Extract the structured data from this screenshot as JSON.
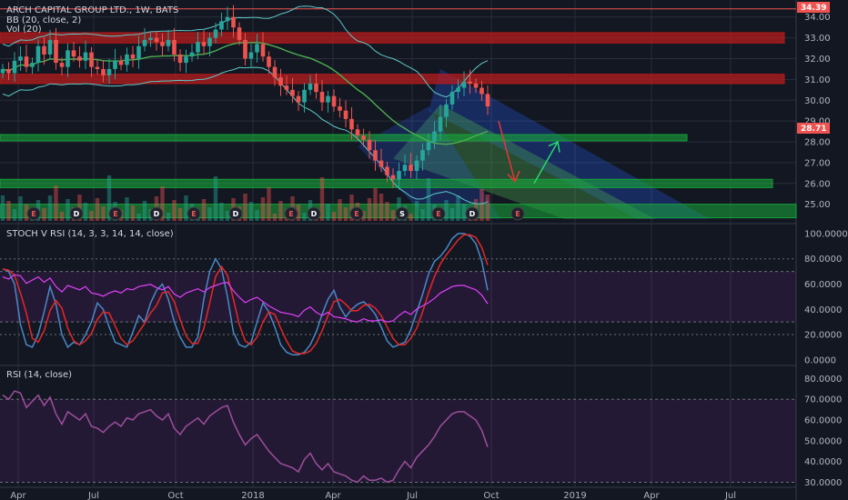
{
  "header": {
    "symbol_line": "ARCH CAPITAL GROUP LTD., 1W, BATS",
    "bb_label": "BB (20, close, 2)",
    "vol_label": "Vol (20)"
  },
  "price_tags": {
    "top": "34.39",
    "last": "28.71"
  },
  "earnings_markers": [
    "E",
    "D",
    "E",
    "D",
    "E",
    "D",
    "E",
    "D",
    "E",
    "S",
    "E",
    "D",
    "E"
  ],
  "colors": {
    "background": "#131722",
    "grid": "#2a2e39",
    "up": "#26a69a",
    "down": "#ef5350",
    "bb": "#5ec7c7",
    "sma": "#4caf50",
    "stoch_k": "#4a88c7",
    "stoch_d": "#e52727",
    "rsi": "#9c4f9c",
    "zone_red": "#b71c1c",
    "zone_green": "#17a83a"
  },
  "chart_data": [
    {
      "type": "candlestick",
      "title": "ARCH CAPITAL GROUP LTD., 1W, BATS",
      "x_ticks": [
        "Apr",
        "Jul",
        "Oct",
        "2018",
        "Apr",
        "Jul",
        "Oct",
        "2019",
        "Apr",
        "Jul"
      ],
      "y_ticks": [
        25.0,
        26.0,
        27.0,
        28.0,
        29.0,
        30.0,
        31.0,
        32.0,
        33.0,
        34.0
      ],
      "ylim": [
        24.2,
        34.6
      ],
      "close": [
        31.5,
        31.3,
        31.9,
        32.1,
        31.6,
        31.8,
        32.6,
        32.2,
        32.9,
        31.8,
        31.6,
        32.4,
        32.1,
        31.9,
        32.3,
        31.6,
        31.5,
        31.2,
        31.5,
        31.9,
        31.7,
        32.2,
        32.0,
        32.6,
        32.9,
        33.0,
        32.8,
        32.6,
        32.9,
        32.2,
        31.8,
        32.1,
        32.3,
        32.8,
        32.6,
        33.0,
        33.4,
        33.8,
        34.0,
        33.5,
        32.9,
        32.0,
        32.3,
        32.7,
        32.1,
        31.6,
        31.1,
        30.7,
        30.5,
        30.2,
        29.9,
        30.5,
        30.8,
        30.4,
        29.9,
        30.2,
        29.7,
        29.5,
        29.1,
        28.6,
        28.3,
        28.1,
        27.6,
        27.1,
        26.8,
        26.4,
        26.2,
        26.6,
        26.9,
        26.6,
        27.1,
        27.6,
        28.0,
        28.5,
        29.2,
        29.8,
        30.4,
        30.6,
        30.9,
        30.8,
        30.6,
        30.3,
        29.7
      ],
      "overlays": [
        "BB (20, close, 2)",
        "Vol (20)"
      ],
      "annotations": [
        "resistance zones 33.0, 31.0",
        "support zones 28.2, 26.0, 24.7",
        "regression channel",
        "down arrow",
        "up arrow"
      ]
    },
    {
      "type": "line",
      "title": "STOCH V RSI (14, 3, 3, 14, 14, close)",
      "y_ticks": [
        0,
        20,
        40,
        60,
        80,
        100
      ],
      "y_tick_labels": [
        "0.0000",
        "20.0000",
        "40.0000",
        "60.0000",
        "80.0000",
        "100.0000"
      ],
      "ylim": [
        -3,
        105
      ],
      "bands": [
        30,
        70
      ],
      "series": [
        {
          "name": "K",
          "values": [
            72,
            70,
            60,
            28,
            12,
            10,
            20,
            38,
            58,
            44,
            20,
            10,
            14,
            12,
            20,
            30,
            45,
            40,
            26,
            14,
            12,
            10,
            22,
            35,
            30,
            45,
            55,
            60,
            48,
            30,
            18,
            10,
            10,
            18,
            48,
            70,
            80,
            72,
            50,
            22,
            12,
            10,
            14,
            30,
            45,
            38,
            26,
            12,
            6,
            4,
            4,
            6,
            12,
            22,
            36,
            48,
            55,
            42,
            34,
            40,
            44,
            46,
            42,
            36,
            26,
            15,
            10,
            12,
            14,
            24,
            38,
            52,
            68,
            78,
            82,
            88,
            96,
            100,
            100,
            98,
            92,
            78,
            55
          ]
        },
        {
          "name": "D",
          "values": [
            72,
            71,
            67,
            53,
            37,
            17,
            14,
            23,
            39,
            47,
            41,
            25,
            15,
            12,
            15,
            21,
            32,
            38,
            37,
            27,
            17,
            12,
            15,
            22,
            29,
            37,
            43,
            53,
            54,
            46,
            32,
            19,
            13,
            13,
            25,
            45,
            66,
            74,
            67,
            48,
            28,
            15,
            12,
            18,
            30,
            38,
            36,
            25,
            15,
            7,
            5,
            5,
            7,
            13,
            23,
            35,
            46,
            48,
            44,
            39,
            39,
            43,
            44,
            41,
            35,
            26,
            17,
            12,
            12,
            17,
            25,
            38,
            53,
            66,
            76,
            83,
            89,
            95,
            99,
            99,
            97,
            89,
            75
          ]
        }
      ]
    },
    {
      "type": "line",
      "title": "RSI (14, close)",
      "y_ticks": [
        30,
        40,
        50,
        60,
        70,
        80
      ],
      "y_tick_labels": [
        "30.0000",
        "40.0000",
        "50.0000",
        "60.0000",
        "70.0000",
        "80.0000"
      ],
      "ylim": [
        28,
        85
      ],
      "bands": [
        30,
        70
      ],
      "series": [
        {
          "name": "RSI",
          "values": [
            72,
            70,
            74,
            73,
            66,
            69,
            72,
            67,
            71,
            63,
            58,
            64,
            62,
            60,
            63,
            57,
            56,
            54,
            57,
            59,
            57,
            61,
            60,
            63,
            64,
            65,
            62,
            60,
            63,
            56,
            53,
            57,
            59,
            61,
            58,
            62,
            64,
            66,
            67,
            59,
            53,
            48,
            51,
            53,
            49,
            45,
            42,
            39,
            38,
            37,
            35,
            41,
            44,
            39,
            36,
            39,
            35,
            34,
            33,
            31,
            30,
            33,
            31,
            31,
            32,
            30,
            31,
            36,
            40,
            37,
            42,
            45,
            48,
            52,
            57,
            60,
            63,
            64,
            64,
            62,
            60,
            55,
            47
          ]
        }
      ]
    }
  ]
}
